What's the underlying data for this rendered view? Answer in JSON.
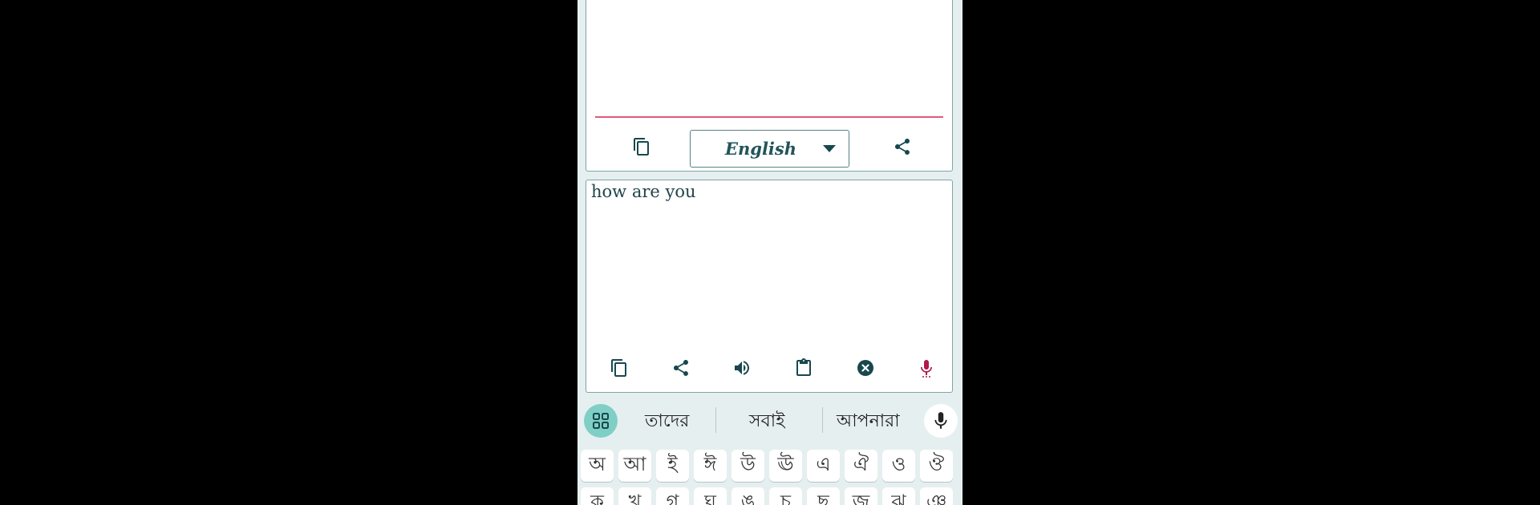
{
  "top_card": {
    "language": "English"
  },
  "input_card": {
    "text": "how are you"
  },
  "keyboard": {
    "suggestions": [
      "তাদের",
      "সবাই",
      "আপনারা"
    ],
    "row1": [
      "অ",
      "আ",
      "ই",
      "ঈ",
      "উ",
      "ঊ",
      "এ",
      "ঐ",
      "ও",
      "ঔ"
    ],
    "row2": [
      "ক",
      "খ",
      "গ",
      "ঘ",
      "ঙ",
      "চ",
      "ছ",
      "জ",
      "ঝ",
      "ঞ"
    ]
  },
  "colors": {
    "accent": "#17484d",
    "mic": "#b0184e",
    "underline": "#e05a7a",
    "grid_button": "#7fcfc6"
  }
}
